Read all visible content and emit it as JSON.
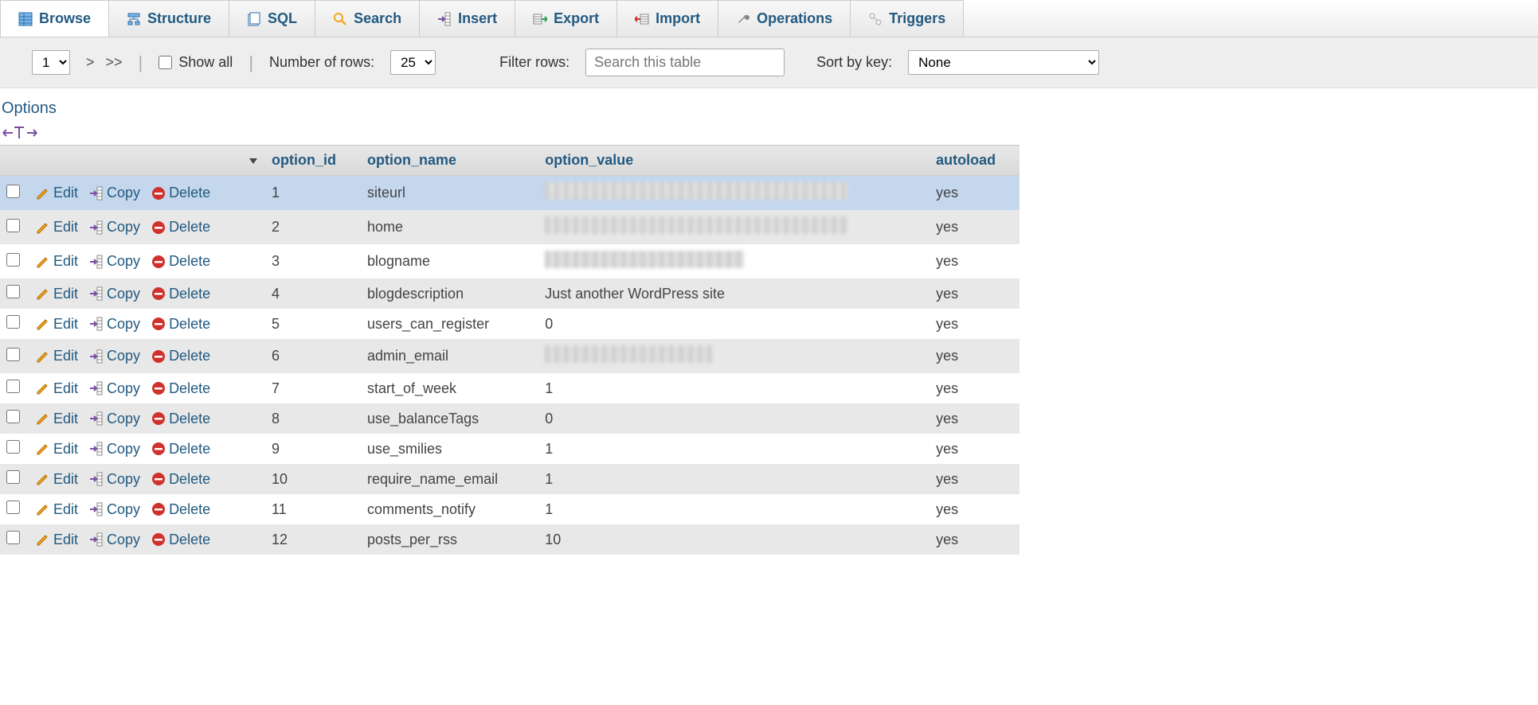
{
  "tabs": [
    {
      "label": "Browse",
      "active": true
    },
    {
      "label": "Structure"
    },
    {
      "label": "SQL"
    },
    {
      "label": "Search"
    },
    {
      "label": "Insert"
    },
    {
      "label": "Export"
    },
    {
      "label": "Import"
    },
    {
      "label": "Operations"
    },
    {
      "label": "Triggers"
    }
  ],
  "toolbar": {
    "page_select": "1",
    "next": ">",
    "last": ">>",
    "show_all": "Show all",
    "num_rows_label": "Number of rows:",
    "rows_select": "25",
    "filter_label": "Filter rows:",
    "filter_placeholder": "Search this table",
    "sort_label": "Sort by key:",
    "sort_select": "None"
  },
  "options_heading": "Options",
  "headers": {
    "option_id": "option_id",
    "option_name": "option_name",
    "option_value": "option_value",
    "autoload": "autoload"
  },
  "actions": {
    "edit": "Edit",
    "copy": "Copy",
    "delete": "Delete"
  },
  "rows": [
    {
      "id": "1",
      "name": "siteurl",
      "value": "[redacted]",
      "autoload": "yes",
      "blurclass": ""
    },
    {
      "id": "2",
      "name": "home",
      "value": "[redacted]",
      "autoload": "yes",
      "blurclass": ""
    },
    {
      "id": "3",
      "name": "blogname",
      "value": "[redacted]",
      "autoload": "yes",
      "blurclass": "short"
    },
    {
      "id": "4",
      "name": "blogdescription",
      "value": "Just another WordPress site",
      "autoload": "yes"
    },
    {
      "id": "5",
      "name": "users_can_register",
      "value": "0",
      "autoload": "yes"
    },
    {
      "id": "6",
      "name": "admin_email",
      "value": "[redacted]",
      "autoload": "yes",
      "blurclass": "shorter"
    },
    {
      "id": "7",
      "name": "start_of_week",
      "value": "1",
      "autoload": "yes"
    },
    {
      "id": "8",
      "name": "use_balanceTags",
      "value": "0",
      "autoload": "yes"
    },
    {
      "id": "9",
      "name": "use_smilies",
      "value": "1",
      "autoload": "yes"
    },
    {
      "id": "10",
      "name": "require_name_email",
      "value": "1",
      "autoload": "yes"
    },
    {
      "id": "11",
      "name": "comments_notify",
      "value": "1",
      "autoload": "yes"
    },
    {
      "id": "12",
      "name": "posts_per_rss",
      "value": "10",
      "autoload": "yes"
    }
  ]
}
